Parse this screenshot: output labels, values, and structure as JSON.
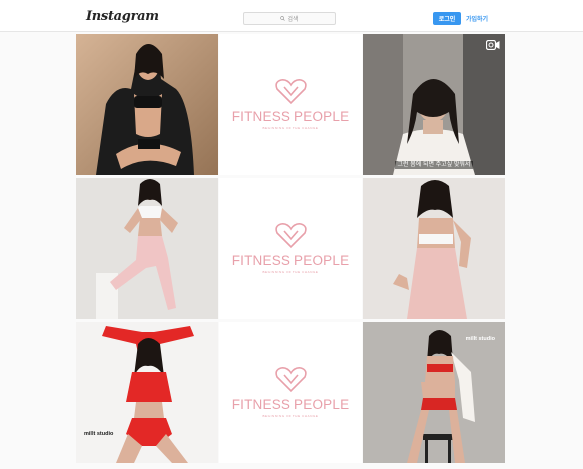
{
  "header": {
    "logo": "Instagram",
    "search_placeholder": "검색",
    "login_label": "로그인",
    "signup_label": "가입하기"
  },
  "grid": {
    "brand": {
      "name": "FITNESS PEOPLE",
      "tagline": "BEGINNING OF THE CHANGE"
    },
    "video_caption": "그런 몸에 되면 주고싶 맞워서",
    "studio_label": "millt studio",
    "colors": {
      "brand_pink": "#e8a0aa",
      "accent_blue": "#3897f0"
    }
  }
}
